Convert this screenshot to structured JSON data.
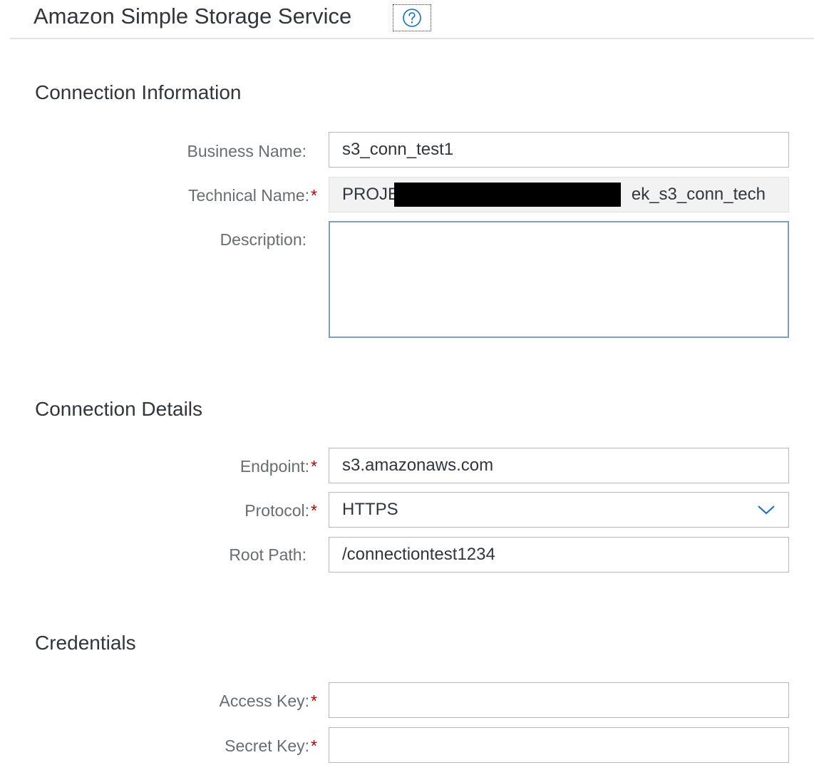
{
  "header": {
    "title": "Amazon Simple Storage Service",
    "help_icon": "help-circle-icon"
  },
  "sections": {
    "connection_information": {
      "title": "Connection Information",
      "business_name": {
        "label": "Business Name:",
        "value": "s3_conn_test1"
      },
      "technical_name": {
        "label": "Technical Name:",
        "required": "*",
        "value_start": "PROJE",
        "value_end": "ek_s3_conn_tech"
      },
      "description": {
        "label": "Description:",
        "value": ""
      }
    },
    "connection_details": {
      "title": "Connection Details",
      "endpoint": {
        "label": "Endpoint:",
        "required": "*",
        "value": "s3.amazonaws.com"
      },
      "protocol": {
        "label": "Protocol:",
        "required": "*",
        "value": "HTTPS",
        "icon": "chevron-down-icon"
      },
      "root_path": {
        "label": "Root Path:",
        "value": "/connectiontest1234"
      }
    },
    "credentials": {
      "title": "Credentials",
      "access_key": {
        "label": "Access Key:",
        "required": "*",
        "value": ""
      },
      "secret_key": {
        "label": "Secret Key:",
        "required": "*",
        "value": ""
      }
    }
  },
  "colors": {
    "required": "#bb0000",
    "label": "#6a6d70",
    "text": "#32363a",
    "focus_border": "#7f9fbf",
    "accent": "#0a6ed1"
  }
}
